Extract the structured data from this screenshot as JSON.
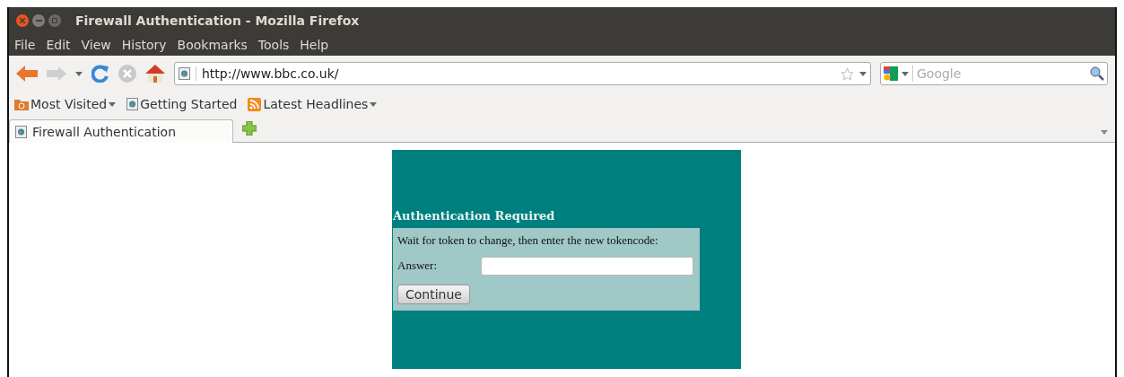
{
  "window": {
    "title": "Firewall Authentication - Mozilla Firefox"
  },
  "menu": [
    "File",
    "Edit",
    "View",
    "History",
    "Bookmarks",
    "Tools",
    "Help"
  ],
  "navigation": {
    "forward_disabled": true,
    "stop_disabled": true,
    "url": "http://www.bbc.co.uk/",
    "search": {
      "placeholder": "Google"
    }
  },
  "bookmarks": [
    {
      "label": "Most Visited",
      "kind": "folder"
    },
    {
      "label": "Getting Started",
      "kind": "page"
    },
    {
      "label": "Latest Headlines",
      "kind": "feed"
    }
  ],
  "tabs": [
    {
      "label": "Firewall Authentication",
      "selected": true
    }
  ],
  "page": {
    "heading": "Authentication Required",
    "instruction": "Wait for token to change, then enter the new tokencode:",
    "answer_label": "Answer:",
    "button": "Continue"
  }
}
